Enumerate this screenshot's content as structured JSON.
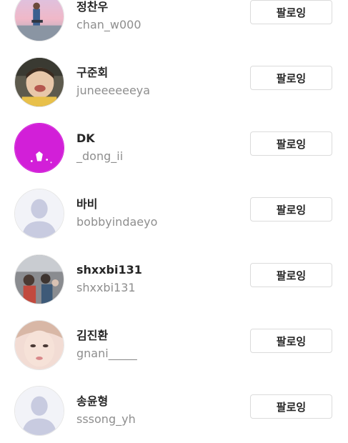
{
  "following_list": [
    {
      "display_name": "정찬우",
      "username": "chan_w000",
      "button_label": "팔로잉",
      "avatar": "photo-pink-sky"
    },
    {
      "display_name": "구준회",
      "username": "juneeeeeeya",
      "button_label": "팔로잉",
      "avatar": "photo-baby"
    },
    {
      "display_name": "DK",
      "username": "_dong_ii",
      "button_label": "팔로잉",
      "avatar": "photo-magenta-stage"
    },
    {
      "display_name": "바비",
      "username": "bobbyindaeyo",
      "button_label": "팔로잉",
      "avatar": "default-person-icon"
    },
    {
      "display_name": "shxxbi131",
      "username": "shxxbi131",
      "button_label": "팔로잉",
      "avatar": "photo-crowd"
    },
    {
      "display_name": "김진환",
      "username": "gnani_____",
      "button_label": "팔로잉",
      "avatar": "photo-face"
    },
    {
      "display_name": "송윤형",
      "username": "sssong_yh",
      "button_label": "팔로잉",
      "avatar": "default-person-icon"
    }
  ]
}
